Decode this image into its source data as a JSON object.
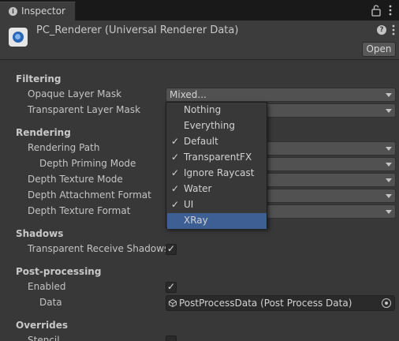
{
  "tab": {
    "title": "Inspector"
  },
  "header": {
    "asset_title": "PC_Renderer (Universal Renderer Data)",
    "open_label": "Open"
  },
  "sections": {
    "filtering": "Filtering",
    "rendering": "Rendering",
    "shadows": "Shadows",
    "post_processing": "Post-processing",
    "overrides": "Overrides"
  },
  "fields": {
    "opaque_layer_mask": {
      "label": "Opaque Layer Mask",
      "value": "Mixed..."
    },
    "transparent_layer_mask": {
      "label": "Transparent Layer Mask",
      "value": ""
    },
    "rendering_path": {
      "label": "Rendering Path",
      "value": ""
    },
    "depth_priming_mode": {
      "label": "Depth Priming Mode",
      "value": ""
    },
    "depth_texture_mode": {
      "label": "Depth Texture Mode",
      "value": ""
    },
    "depth_attachment_format": {
      "label": "Depth Attachment Format",
      "value": ""
    },
    "depth_texture_format": {
      "label": "Depth Texture Format",
      "value": ""
    },
    "transparent_receive_shadows": {
      "label": "Transparent Receive Shadows",
      "checked": true
    },
    "enabled": {
      "label": "Enabled",
      "checked": true
    },
    "data": {
      "label": "Data",
      "value": "PostProcessData (Post Process Data)"
    },
    "stencil": {
      "label": "Stencil",
      "checked": false
    }
  },
  "popup": {
    "items": [
      {
        "label": "Nothing",
        "checked": false,
        "highlighted": false
      },
      {
        "label": "Everything",
        "checked": false,
        "highlighted": false
      },
      {
        "label": "Default",
        "checked": true,
        "highlighted": false
      },
      {
        "label": "TransparentFX",
        "checked": true,
        "highlighted": false
      },
      {
        "label": "Ignore Raycast",
        "checked": true,
        "highlighted": false
      },
      {
        "label": "Water",
        "checked": true,
        "highlighted": false
      },
      {
        "label": "UI",
        "checked": true,
        "highlighted": false
      },
      {
        "label": "XRay",
        "checked": false,
        "highlighted": true
      }
    ]
  },
  "glyphs": {
    "check": "✓"
  },
  "colors": {
    "highlight": "#3d5f93",
    "background": "#383838"
  }
}
